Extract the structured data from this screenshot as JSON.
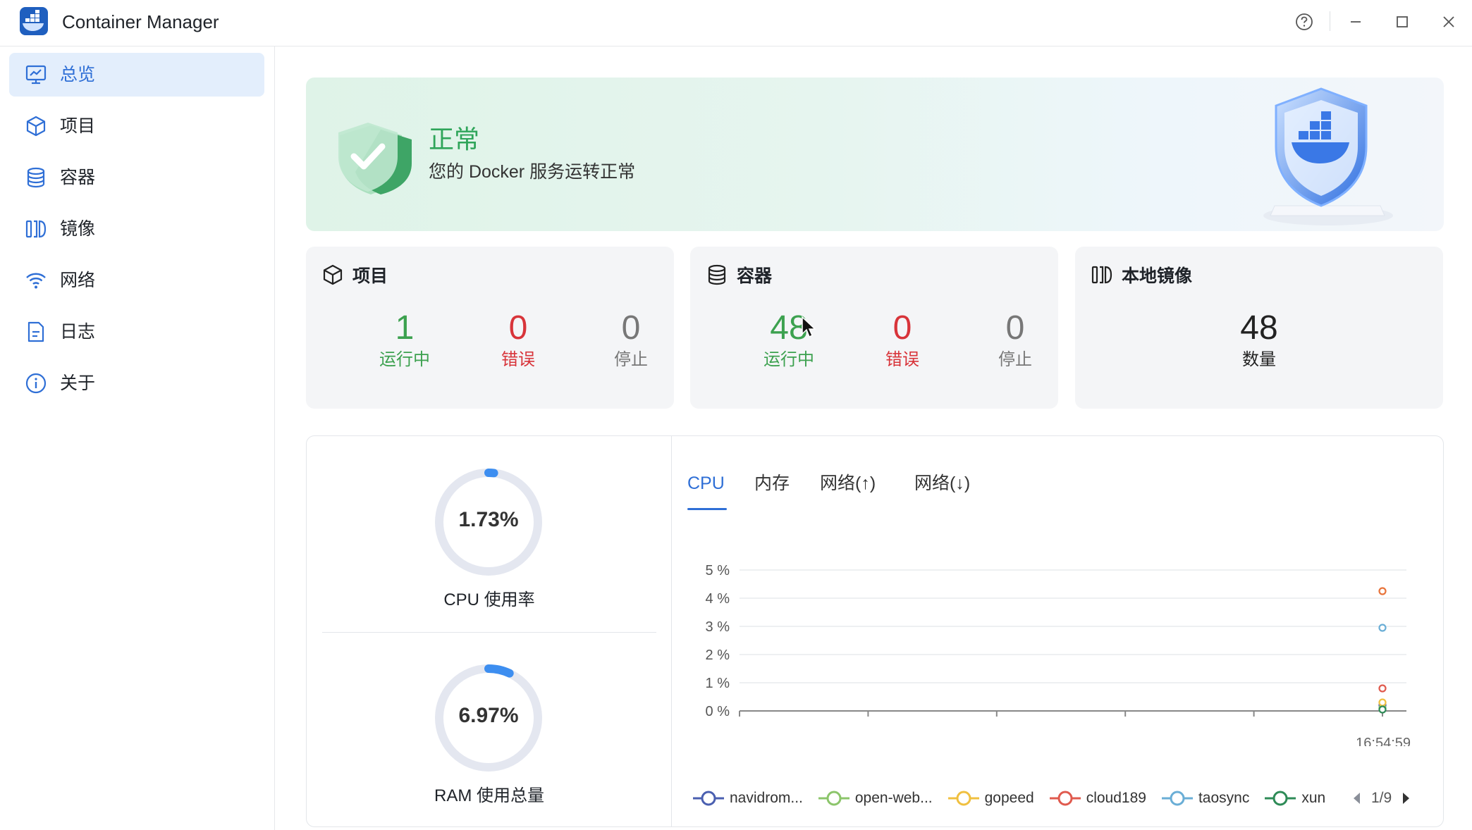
{
  "window": {
    "title": "Container Manager"
  },
  "sidebar": {
    "items": [
      {
        "label": "总览",
        "icon": "dashboard-icon",
        "active": true
      },
      {
        "label": "项目",
        "icon": "cube-icon"
      },
      {
        "label": "容器",
        "icon": "database-icon"
      },
      {
        "label": "镜像",
        "icon": "image-layers-icon"
      },
      {
        "label": "网络",
        "icon": "wifi-icon"
      },
      {
        "label": "日志",
        "icon": "document-icon"
      },
      {
        "label": "关于",
        "icon": "info-icon"
      }
    ]
  },
  "status": {
    "title": "正常",
    "subtitle": "您的 Docker 服务运转正常"
  },
  "cards": {
    "projects": {
      "title": "项目",
      "running": "1",
      "running_label": "运行中",
      "error": "0",
      "error_label": "错误",
      "stopped": "0",
      "stopped_label": "停止"
    },
    "containers": {
      "title": "容器",
      "running": "48",
      "running_label": "运行中",
      "error": "0",
      "error_label": "错误",
      "stopped": "0",
      "stopped_label": "停止"
    },
    "images": {
      "title": "本地镜像",
      "count": "48",
      "count_label": "数量"
    }
  },
  "gauges": {
    "cpu": {
      "value": "1.73%",
      "fraction": 0.0173,
      "label": "CPU 使用率"
    },
    "ram": {
      "value": "6.97%",
      "fraction": 0.0697,
      "label": "RAM 使用总量"
    }
  },
  "tabs": [
    "CPU",
    "内存",
    "网络(↑)",
    "网络(↓)"
  ],
  "chart_data": {
    "type": "scatter",
    "y_ticks": [
      "5 %",
      "4 %",
      "3 %",
      "2 %",
      "1 %",
      "0 %"
    ],
    "ylim": [
      0,
      5
    ],
    "x_labels": [
      "16:54:59"
    ],
    "series": [
      {
        "name": "navidrom...",
        "color": "#4a5fb0",
        "values": [
          0.2
        ]
      },
      {
        "name": "open-web...",
        "color": "#8cc56b",
        "values": [
          0.1
        ]
      },
      {
        "name": "gopeed",
        "color": "#f0c040",
        "values": [
          0.3
        ]
      },
      {
        "name": "cloud189",
        "color": "#e05a4e",
        "values": [
          0.8
        ]
      },
      {
        "name": "taosync",
        "color": "#6aaed6",
        "values": [
          2.95
        ]
      },
      {
        "name": "xun",
        "color": "#2e8b57",
        "values": [
          0.05
        ]
      },
      {
        "name": "",
        "color": "#e8743b",
        "values": [
          4.25
        ]
      }
    ],
    "pager": "1/9"
  },
  "colors": {
    "accent": "#2f6fd6",
    "running": "#3ca14f",
    "error": "#d8343a"
  }
}
